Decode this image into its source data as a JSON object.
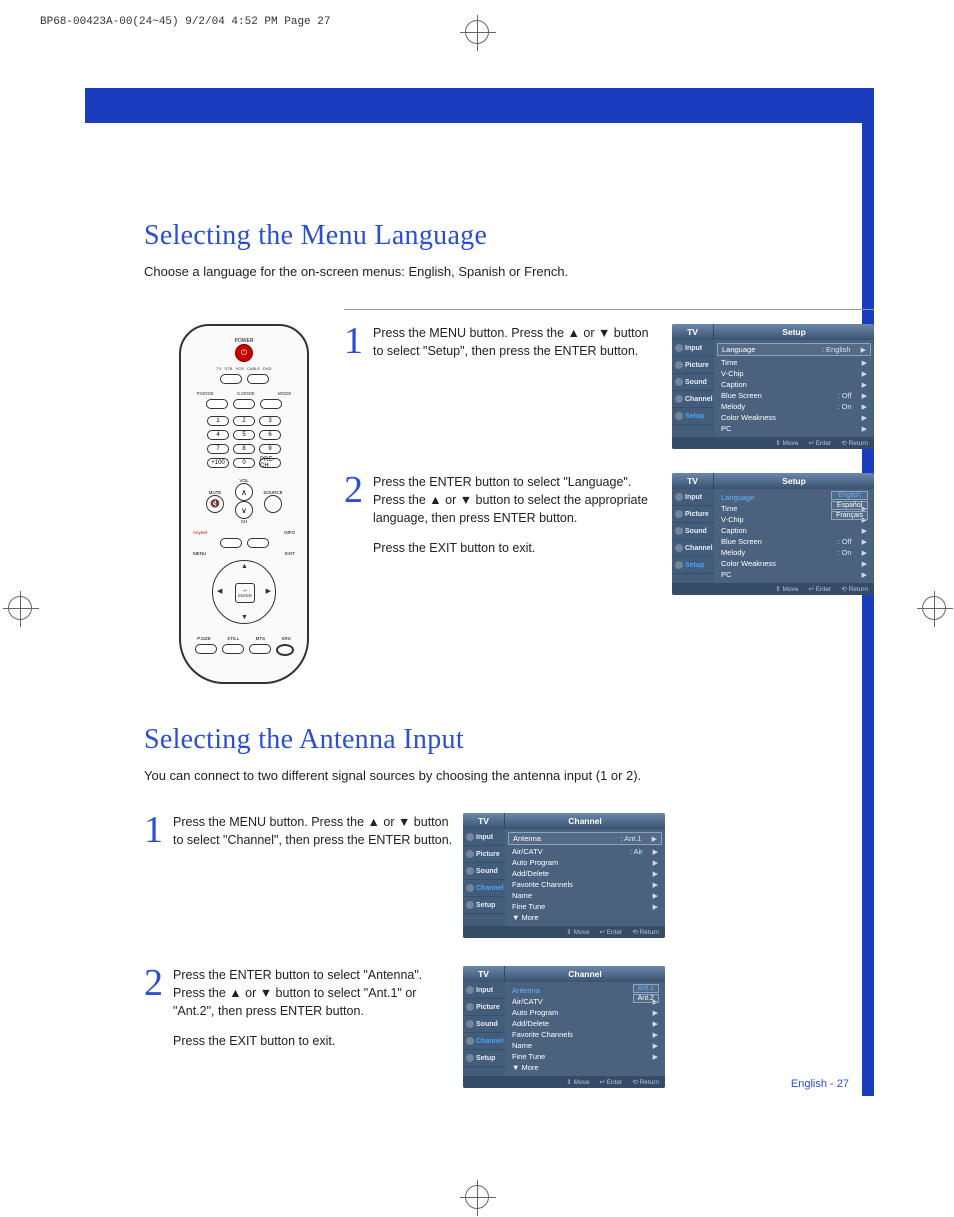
{
  "header_line": "BP68-00423A-00(24~45)  9/2/04  4:52 PM  Page 27",
  "page_footer": "English - 27",
  "section1": {
    "title": "Selecting the Menu Language",
    "intro": "Choose a language for the on-screen menus: English, Spanish or French.",
    "steps": [
      {
        "num": "1",
        "text": "Press the MENU button.\nPress the ▲ or ▼ button to select \"Setup\", then press the ENTER button."
      },
      {
        "num": "2",
        "text": "Press the ENTER button to select \"Language\".\nPress the ▲ or ▼ button to select the appropriate language, then press ENTER button.",
        "text_after": "Press the EXIT button to exit."
      }
    ]
  },
  "section2": {
    "title": "Selecting the Antenna Input",
    "intro": "You can connect to two different signal sources by choosing the antenna input (1 or 2).",
    "steps": [
      {
        "num": "1",
        "text": "Press the MENU button.\nPress the ▲ or ▼ button to select \"Channel\", then press the ENTER button."
      },
      {
        "num": "2",
        "text": "Press the ENTER button to select \"Antenna\".\nPress the ▲ or ▼ button to select \"Ant.1\" or \"Ant.2\", then press ENTER button.",
        "text_after": "Press the EXIT button to exit."
      }
    ]
  },
  "osd": {
    "tv_label": "TV",
    "side_items": [
      "Input",
      "Picture",
      "Sound",
      "Channel",
      "Setup"
    ],
    "footer": {
      "move": "Move",
      "enter": "Enter",
      "return": "Return"
    },
    "setup1": {
      "title": "Setup",
      "rows": [
        {
          "label": "Language",
          "val": ": English",
          "boxed": true
        },
        {
          "label": "Time"
        },
        {
          "label": "V-Chip"
        },
        {
          "label": "Caption"
        },
        {
          "label": "Blue Screen",
          "val": ": Off"
        },
        {
          "label": "Melody",
          "val": ": On"
        },
        {
          "label": "Color Weakness"
        },
        {
          "label": "PC"
        }
      ]
    },
    "setup2": {
      "title": "Setup",
      "highlight_label": "Language",
      "options": [
        "English",
        "Español",
        "Français"
      ],
      "rows": [
        {
          "label": "Time"
        },
        {
          "label": "V-Chip"
        },
        {
          "label": "Caption"
        },
        {
          "label": "Blue Screen",
          "val": ": Off"
        },
        {
          "label": "Melody",
          "val": ": On"
        },
        {
          "label": "Color Weakness"
        },
        {
          "label": "PC"
        }
      ]
    },
    "channel1": {
      "title": "Channel",
      "rows": [
        {
          "label": "Antenna",
          "val": ": Ant.1",
          "boxed": true
        },
        {
          "label": "Air/CATV",
          "val": ": Air"
        },
        {
          "label": "Auto Program"
        },
        {
          "label": "Add/Delete"
        },
        {
          "label": "Favorite Channels"
        },
        {
          "label": "Name"
        },
        {
          "label": "Fine Tune"
        },
        {
          "label": "▼ More",
          "noarrow": true
        }
      ]
    },
    "channel2": {
      "title": "Channel",
      "highlight_label": "Antenna",
      "options": [
        "Ant.1",
        "Ant.2"
      ],
      "rows": [
        {
          "label": "Air/CATV"
        },
        {
          "label": "Auto Program"
        },
        {
          "label": "Add/Delete"
        },
        {
          "label": "Favorite Channels"
        },
        {
          "label": "Name"
        },
        {
          "label": "Fine Tune"
        },
        {
          "label": "▼ More",
          "noarrow": true
        }
      ]
    }
  },
  "remote": {
    "power": "POWER",
    "devices": [
      "TV",
      "STB",
      "VCR",
      "CABLE",
      "DVD"
    ],
    "mode_labels": [
      "P.MODE",
      "S.MODE",
      "MODE"
    ],
    "nums": [
      "1",
      "2",
      "3",
      "4",
      "5",
      "6",
      "7",
      "8",
      "9",
      "+100",
      "0",
      "PRE-CH"
    ],
    "vol": "VOL",
    "ch": "CH",
    "mute": "MUTE",
    "source": "SOURCE",
    "info": "INFO",
    "menu": "MENU",
    "exit": "EXIT",
    "enter": "ENTER",
    "bottom": [
      "P.SIZE",
      "STILL",
      "MTS",
      "SRS"
    ]
  }
}
